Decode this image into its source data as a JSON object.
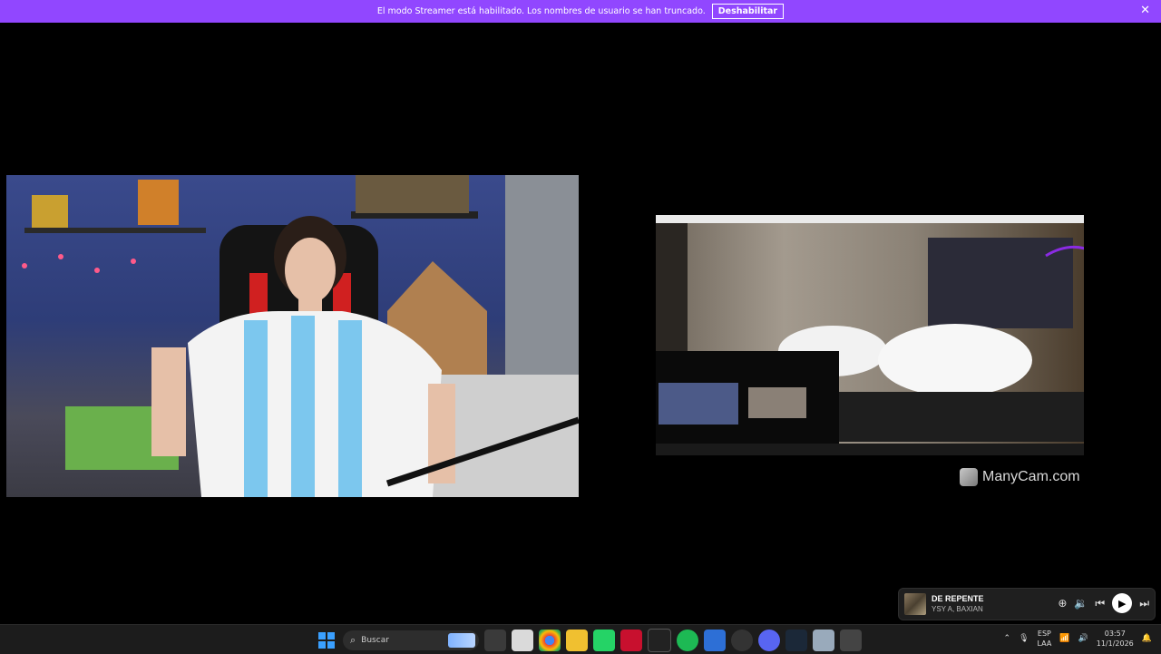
{
  "banner": {
    "message": "El modo Streamer está habilitado. Los nombres de usuario se han truncado.",
    "button": "Deshabilitar",
    "close": "✕"
  },
  "overlay": {
    "manycam": "ManyCam.com"
  },
  "media": {
    "title": "DE REPENTE",
    "artist": "YSY A, BAXIAN"
  },
  "taskbar": {
    "search_placeholder": "Buscar",
    "apps": [
      "chrome-icon",
      "file-explorer-icon",
      "whatsapp-icon",
      "video-app-icon",
      "bm-app-icon",
      "spotify-icon",
      "app-icon",
      "steam-alt-icon",
      "discord-icon",
      "steam-icon",
      "screenshot-icon",
      "task-icon"
    ],
    "tray": {
      "lang_top": "ESP",
      "lang_bottom": "LAA",
      "time": "03:57",
      "date": "11/1/2026"
    }
  },
  "colors": {
    "banner": "#9147ff",
    "taskbar": "#1c1c1c"
  }
}
